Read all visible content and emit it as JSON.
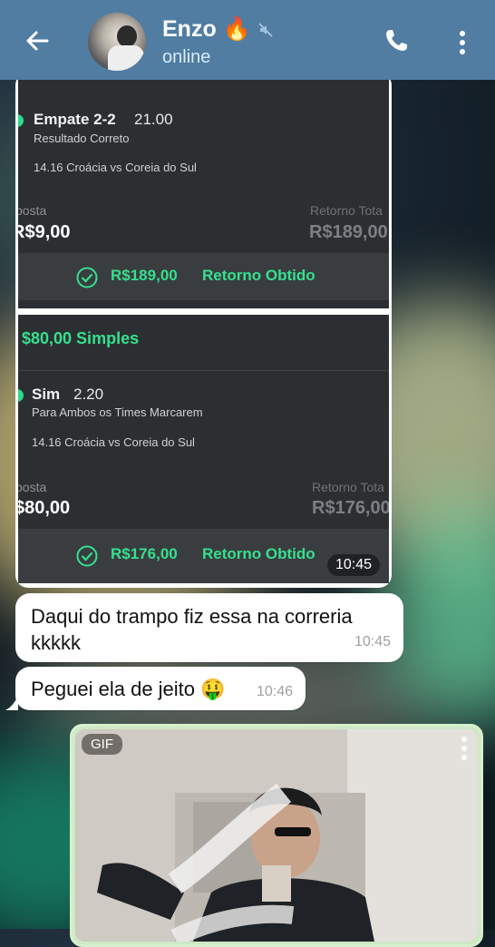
{
  "header": {
    "name": "Enzo 🔥",
    "status": "online",
    "icons": [
      "back-arrow-icon",
      "muted-icon",
      "phone-icon",
      "more-vertical-icon"
    ]
  },
  "bet_card_1": {
    "selection": "Empate 2-2",
    "odd": "21.00",
    "market": "Resultado Correto",
    "event": "14.16 Croácia vs Coreia do Sul",
    "stake_label": "posta",
    "stake": "R$9,00",
    "return_label": "Retorno Tota",
    "return_value": "R$189,00",
    "result_amount": "R$189,00",
    "result_label": "Retorno Obtido"
  },
  "bet_card_2": {
    "header": "$80,00 Simples",
    "selection": "Sim",
    "odd": "2.20",
    "market": "Para Ambos os Times Marcarem",
    "event": "14.16 Croácia vs Coreia do Sul",
    "stake_label": "posta",
    "stake": "$80,00",
    "return_label": "Retorno Tota",
    "return_value": "R$176,00",
    "result_amount": "R$176,00",
    "result_label": "Retorno Obtido",
    "time": "10:45"
  },
  "messages": [
    {
      "text": "Daqui do trampo fiz essa na correria kkkkk",
      "time": "10:45"
    },
    {
      "text": "Peguei ela de jeito 🤑",
      "time": "10:46"
    }
  ],
  "gif": {
    "label": "GIF"
  },
  "colors": {
    "header": "#517da2",
    "accent_green": "#35e08e",
    "card_bg": "#2c2f31"
  }
}
